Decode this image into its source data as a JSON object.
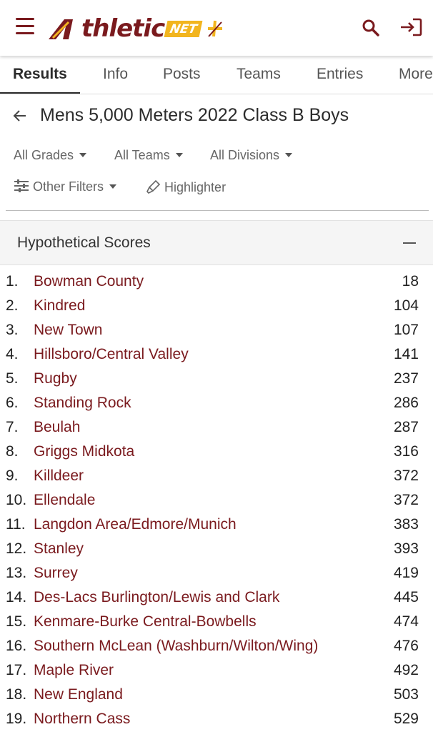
{
  "header": {
    "logo_text": "thletic",
    "logo_badge": "NET",
    "brand_colors": {
      "maroon": "#7a1a1e",
      "gold": "#f2b51f"
    }
  },
  "tabs": [
    {
      "label": "Results",
      "active": true
    },
    {
      "label": "Info"
    },
    {
      "label": "Posts"
    },
    {
      "label": "Teams"
    },
    {
      "label": "Entries"
    },
    {
      "label": "More"
    }
  ],
  "page": {
    "title": "Mens 5,000 Meters 2022 Class B Boys"
  },
  "filters": {
    "grades": "All Grades",
    "teams": "All Teams",
    "divisions": "All Divisions",
    "other": "Other Filters",
    "highlighter": "Highlighter"
  },
  "scores": {
    "title": "Hypothetical Scores",
    "rows": [
      {
        "rank": "1.",
        "team": "Bowman County",
        "score": "18"
      },
      {
        "rank": "2.",
        "team": "Kindred",
        "score": "104"
      },
      {
        "rank": "3.",
        "team": "New Town",
        "score": "107"
      },
      {
        "rank": "4.",
        "team": "Hillsboro/Central Valley",
        "score": "141"
      },
      {
        "rank": "5.",
        "team": "Rugby",
        "score": "237"
      },
      {
        "rank": "6.",
        "team": "Standing Rock",
        "score": "286"
      },
      {
        "rank": "7.",
        "team": "Beulah",
        "score": "287"
      },
      {
        "rank": "8.",
        "team": "Griggs Midkota",
        "score": "316"
      },
      {
        "rank": "9.",
        "team": "Killdeer",
        "score": "372"
      },
      {
        "rank": "10.",
        "team": "Ellendale",
        "score": "372"
      },
      {
        "rank": "11.",
        "team": "Langdon Area/Edmore/Munich",
        "score": "383"
      },
      {
        "rank": "12.",
        "team": "Stanley",
        "score": "393"
      },
      {
        "rank": "13.",
        "team": "Surrey",
        "score": "419"
      },
      {
        "rank": "14.",
        "team": "Des-Lacs Burlington/Lewis and Clark",
        "score": "445"
      },
      {
        "rank": "15.",
        "team": "Kenmare-Burke Central-Bowbells",
        "score": "474"
      },
      {
        "rank": "16.",
        "team": "Southern McLean (Washburn/Wilton/Wing)",
        "score": "476"
      },
      {
        "rank": "17.",
        "team": "Maple River",
        "score": "492"
      },
      {
        "rank": "18.",
        "team": "New England",
        "score": "503"
      },
      {
        "rank": "19.",
        "team": "Northern Cass",
        "score": "529"
      }
    ]
  }
}
